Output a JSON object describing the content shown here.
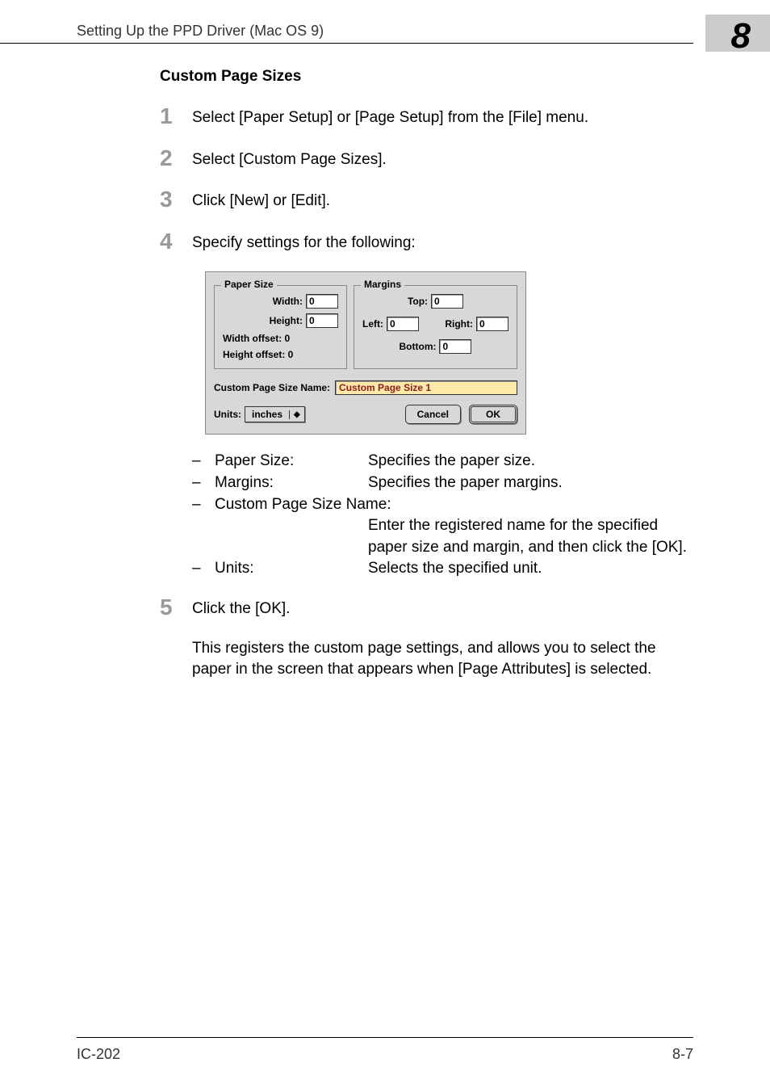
{
  "header": {
    "title": "Setting Up the PPD Driver (Mac OS 9)",
    "chapter_number": "8"
  },
  "section_title": "Custom Page Sizes",
  "steps": [
    {
      "num": "1",
      "text": "Select [Paper Setup] or [Page Setup] from the [File] menu."
    },
    {
      "num": "2",
      "text": "Select [Custom Page Sizes]."
    },
    {
      "num": "3",
      "text": "Click [New] or [Edit]."
    },
    {
      "num": "4",
      "text": "Specify settings for the following:"
    },
    {
      "num": "5",
      "text": "Click the [OK]."
    }
  ],
  "dialog": {
    "paper_size": {
      "legend": "Paper Size",
      "width_label": "Width:",
      "width_value": "0",
      "height_label": "Height:",
      "height_value": "0",
      "width_offset": "Width offset:  0",
      "height_offset": "Height offset:  0"
    },
    "margins": {
      "legend": "Margins",
      "top_label": "Top:",
      "top_value": "0",
      "left_label": "Left:",
      "left_value": "0",
      "right_label": "Right:",
      "right_value": "0",
      "bottom_label": "Bottom:",
      "bottom_value": "0"
    },
    "name_label": "Custom Page Size Name:",
    "name_value": "Custom Page Size 1",
    "units_label": "Units:",
    "units_value": "inches",
    "cancel": "Cancel",
    "ok": "OK"
  },
  "bullets": [
    {
      "label": "Paper Size:",
      "desc": "Specifies the paper size."
    },
    {
      "label": "Margins:",
      "desc": "Specifies the paper margins."
    },
    {
      "label": "Custom Page Size Name:",
      "desc": ""
    },
    {
      "label": "Units:",
      "desc": "Selects the specified unit."
    }
  ],
  "bullet_continuation": "Enter the registered name for the specified paper size and margin, and then click the [OK].",
  "closing_paragraph": "This registers the custom page settings, and allows you to select the paper in the screen that appears when [Page Attributes] is selected.",
  "footer": {
    "left": "IC-202",
    "right": "8-7"
  }
}
